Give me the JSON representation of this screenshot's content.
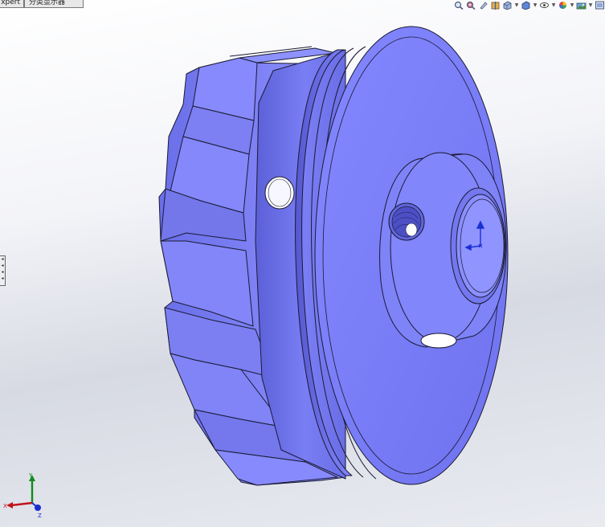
{
  "window": {
    "tabs": [
      {
        "label": "xpert"
      },
      {
        "label": "分类显示器"
      }
    ]
  },
  "toolbar": {
    "icons": [
      {
        "name": "zoom-to-fit-icon"
      },
      {
        "name": "zoom-to-area-icon"
      },
      {
        "name": "previous-view-icon"
      },
      {
        "name": "section-view-icon"
      },
      {
        "name": "view-orientation-icon"
      },
      {
        "name": "display-style-icon"
      },
      {
        "name": "hide-show-items-icon"
      },
      {
        "name": "edit-appearance-icon"
      },
      {
        "name": "apply-scene-icon"
      },
      {
        "name": "view-settings-icon"
      }
    ]
  },
  "model": {
    "name": "impeller-part",
    "color": "#7b7ff5",
    "edge_color": "#1a1a33"
  },
  "triad": {
    "x_label": "X",
    "y_label": "Y",
    "z_label": "Z",
    "x_color": "#c0141a",
    "y_color": "#0f8a1f",
    "z_color": "#1a2bd1"
  }
}
